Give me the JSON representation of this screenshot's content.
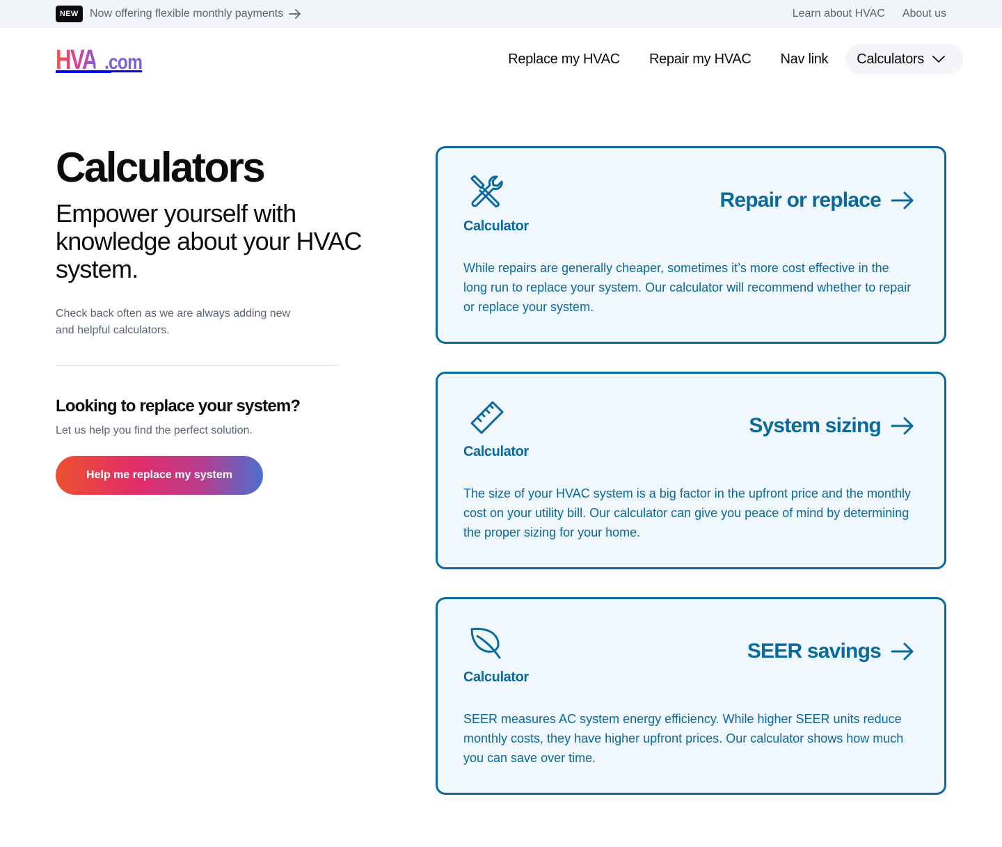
{
  "announcement": {
    "badge": "NEW",
    "text": "Now offering flexible monthly payments"
  },
  "top_links": [
    {
      "label": "Learn about HVAC"
    },
    {
      "label": "About us"
    }
  ],
  "logo": {
    "brand": "HVAC",
    "tld": ".com"
  },
  "nav": {
    "items": [
      {
        "label": "Replace my HVAC"
      },
      {
        "label": "Repair my HVAC"
      },
      {
        "label": "Nav link"
      }
    ],
    "dropdown_label": "Calculators"
  },
  "hero": {
    "title": "Calculators",
    "subtitle": "Empower yourself with knowledge about your HVAC system.",
    "note": "Check back often as we are always adding new and helpful calculators."
  },
  "replace": {
    "title": "Looking to replace your system?",
    "subtitle": "Let us help you find the perfect solution.",
    "button": "Help me replace my system"
  },
  "cards": [
    {
      "icon": "tools-icon",
      "kind": "Calculator",
      "title": "Repair or replace",
      "description": "While repairs are generally cheaper, sometimes it’s more cost effective in the long run to replace your system. Our calculator will recommend whether to repair or replace your system."
    },
    {
      "icon": "ruler-icon",
      "kind": "Calculator",
      "title": "System sizing",
      "description": "The size of your HVAC system is a big factor in the upfront price and the monthly cost on your utility bill. Our calculator can give you peace of mind by determining the proper sizing for your home."
    },
    {
      "icon": "leaf-icon",
      "kind": "Calculator",
      "title": "SEER savings",
      "description": "SEER measures AC system energy efficiency. While higher SEER units reduce monthly costs, they have higher upfront prices. Our calculator shows how much you can save over time."
    }
  ],
  "colors": {
    "accent": "#0a6a9c",
    "card_background": "#f0f7fd",
    "muted_text": "#5b6472",
    "topbar_background": "#f1f4f8"
  }
}
